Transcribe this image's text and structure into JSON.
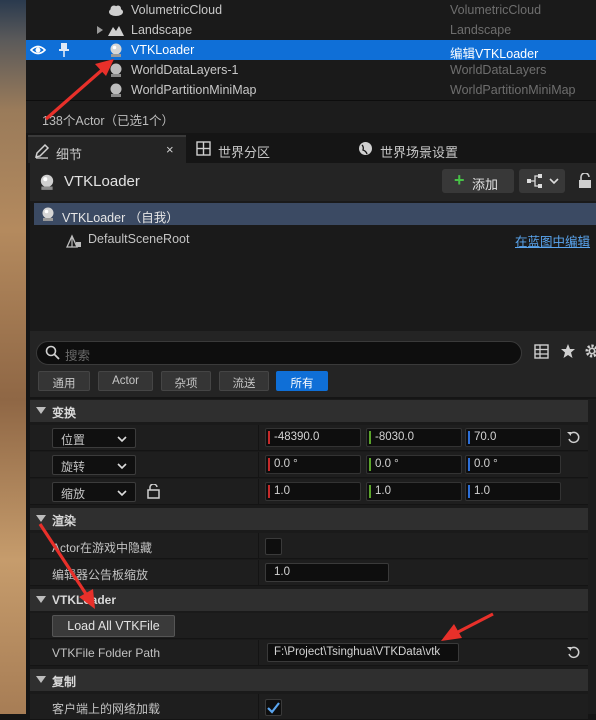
{
  "outliner": {
    "rows": [
      {
        "name": "VolumetricCloud",
        "type": "VolumetricCloud"
      },
      {
        "name": "Landscape",
        "type": "Landscape"
      },
      {
        "name": "VTKLoader",
        "type": "编辑VTKLoader"
      },
      {
        "name": "WorldDataLayers-1",
        "type": "WorldDataLayers"
      },
      {
        "name": "WorldPartitionMiniMap",
        "type": "WorldPartitionMiniMap"
      }
    ],
    "actor_count": "138个Actor（已选1个）"
  },
  "tabs": {
    "details": "细节",
    "world_partition": "世界分区",
    "world_settings": "世界场景设置",
    "close": "×"
  },
  "details": {
    "actor_name": "VTKLoader",
    "add_label": "添加"
  },
  "components": {
    "self": "VTKLoader （自我）",
    "root": "DefaultSceneRoot",
    "edit_in_blueprint": "在蓝图中编辑"
  },
  "search": {
    "placeholder": "搜索"
  },
  "filters": [
    {
      "label": "通用",
      "active": false
    },
    {
      "label": "Actor",
      "active": false
    },
    {
      "label": "杂项",
      "active": false
    },
    {
      "label": "流送",
      "active": false
    },
    {
      "label": "所有",
      "active": true
    }
  ],
  "transform": {
    "category": "变换",
    "location": {
      "label": "位置",
      "x": "-48390.0",
      "y": "-8030.0",
      "z": "70.0"
    },
    "rotation": {
      "label": "旋转",
      "x": "0.0 °",
      "y": "0.0 °",
      "z": "0.0 °"
    },
    "scale": {
      "label": "缩放",
      "x": "1.0",
      "y": "1.0",
      "z": "1.0"
    }
  },
  "rendering": {
    "category": "渲染",
    "hidden_in_game": {
      "label": "Actor在游戏中隐藏",
      "checked": false
    },
    "billboard_scale": {
      "label": "编辑器公告板缩放",
      "value": "1.0"
    }
  },
  "vtkloader": {
    "category": "VTKLoader",
    "load_button": "Load All VTKFile",
    "folder_path": {
      "label": "VTKFile Folder Path",
      "value": "F:\\Project\\Tsinghua\\VTKData\\vtk"
    }
  },
  "replication": {
    "category": "复制",
    "net_load_on_client": {
      "label": "客户端上的网络加载",
      "checked": true
    }
  },
  "colors": {
    "selection": "#0f6fd7",
    "axis_x": "#c62a2a",
    "axis_y": "#5ba52b",
    "axis_z": "#2c6fd8",
    "arrow": "#e8302a"
  }
}
